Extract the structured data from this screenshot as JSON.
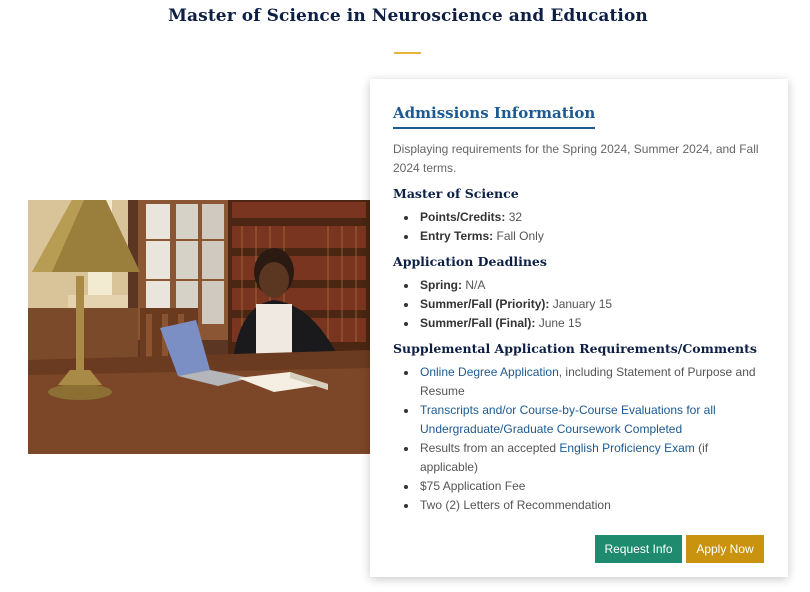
{
  "page": {
    "title": "Master of Science in Neuroscience and Education"
  },
  "colors": {
    "navy": "#0d1f45",
    "blue": "#1c5a91",
    "gold": "#e5b53c",
    "green": "#1e8a6e",
    "apply": "#c9930f"
  },
  "card": {
    "heading": "Admissions Information",
    "intro": "Displaying requirements for the Spring 2024, Summer 2024, and Fall 2024 terms.",
    "program": {
      "heading": "Master of Science",
      "items": [
        {
          "label": "Points/Credits:",
          "value": "32"
        },
        {
          "label": "Entry Terms:",
          "value": "Fall Only"
        }
      ]
    },
    "deadlines": {
      "heading": "Application Deadlines",
      "items": [
        {
          "label": "Spring:",
          "value": "N/A"
        },
        {
          "label": "Summer/Fall (Priority):",
          "value": "January 15"
        },
        {
          "label": "Summer/Fall (Final):",
          "value": "June 15"
        }
      ]
    },
    "supplemental": {
      "heading": "Supplemental Application Requirements/Comments",
      "items": [
        {
          "link": "Online Degree Application",
          "after": ", including Statement of Purpose and Resume"
        },
        {
          "link": "Transcripts and/or Course-by-Course Evaluations for all Undergraduate/Graduate Coursework Completed"
        },
        {
          "before": "Results from an accepted ",
          "link": "English Proficiency Exam",
          "after": " (if applicable)"
        },
        {
          "text": "$75 Application Fee"
        },
        {
          "text": "Two (2) Letters of Recommendation"
        }
      ]
    },
    "buttons": {
      "request_info": "Request Info",
      "apply_now": "Apply Now"
    }
  },
  "photo": {
    "subject": "student-studying-in-library-photo"
  }
}
